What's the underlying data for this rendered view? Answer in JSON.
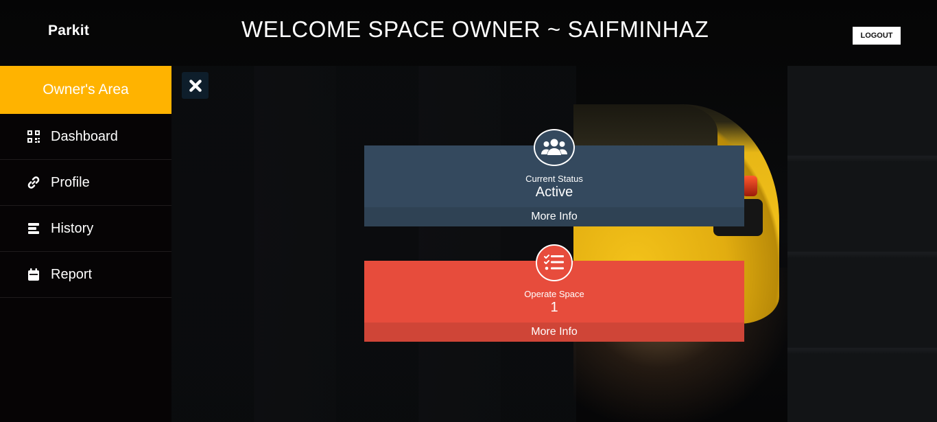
{
  "header": {
    "brand": "Parkit",
    "welcome": "WELCOME SPACE OWNER ~ SAIFMINHAZ",
    "logout_label": "LOGOUT"
  },
  "sidebar": {
    "title": "Owner's Area",
    "items": [
      {
        "label": "Dashboard",
        "icon": "qr-grid-icon"
      },
      {
        "label": "Profile",
        "icon": "link-icon"
      },
      {
        "label": "History",
        "icon": "list-bars-icon"
      },
      {
        "label": "Report",
        "icon": "calendar-icon"
      }
    ]
  },
  "cards": {
    "status": {
      "label": "Current Status",
      "value": "Active",
      "more": "More Info",
      "icon": "users-icon",
      "color": "#34495e"
    },
    "space": {
      "label": "Operate Space",
      "value": "1",
      "more": "More Info",
      "icon": "checklist-icon",
      "color": "#e74c3c"
    }
  },
  "colors": {
    "accent": "#ffb300",
    "sidebar_bg": "#060405",
    "close_bg": "#0e1e2b"
  }
}
